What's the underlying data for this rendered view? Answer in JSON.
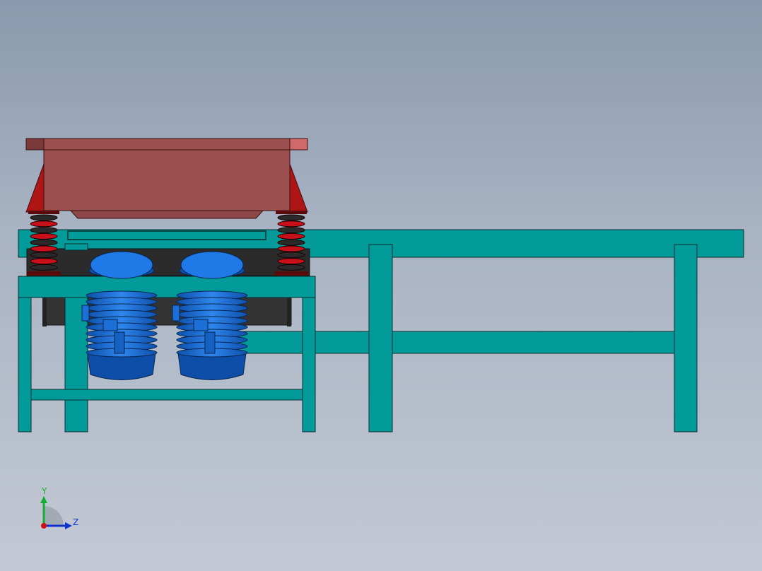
{
  "viewport": {
    "background_top": "#8a99ad",
    "background_bottom": "#c3c9d4"
  },
  "colors": {
    "frame": "#039b9a",
    "table": "#9b4f4f",
    "table_dark": "#8c1616",
    "spring": "#c8101a",
    "motor": "#1b6fd6",
    "base_plate": "#2b2b2b"
  },
  "triad": {
    "y_label": "Y",
    "z_label": "Z",
    "x_color": "#d01010",
    "y_color": "#10b030",
    "z_color": "#1030d0"
  }
}
